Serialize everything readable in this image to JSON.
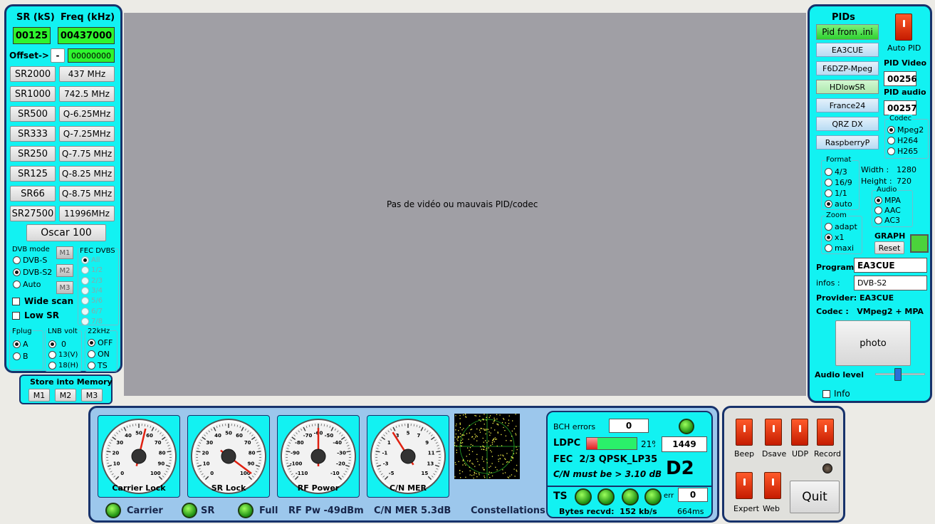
{
  "left": {
    "sr_header": "SR (kS)",
    "freq_header": "Freq (kHz)",
    "sr_value": "00125",
    "freq_value": "00437000",
    "offset_label": "Offset->",
    "offset_sign": "-",
    "offset_value": "00000000",
    "sr_buttons": [
      "SR2000",
      "SR1000",
      "SR500",
      "SR333",
      "SR250",
      "SR125",
      "SR66",
      "SR27500"
    ],
    "freq_buttons": [
      "437 MHz",
      "742.5 MHz",
      "Q-6.25MHz",
      "Q-7.25MHz",
      "Q-7.75 MHz",
      "Q-8.25 MHz",
      "Q-8.75 MHz",
      "11996MHz"
    ],
    "oscar_button": "Oscar 100",
    "dvb_mode_title": "DVB mode",
    "dvb_modes": [
      "DVB-S",
      "DVB-S2",
      "Auto"
    ],
    "m_buttons": [
      "M1",
      "M2",
      "M3"
    ],
    "fec_title": "FEC DVBS",
    "fec_options": [
      "All",
      "1/2",
      "2/3",
      "3/4",
      "5/6",
      "6/7",
      "7/8"
    ],
    "wide_scan": "Wide scan",
    "low_sr": "Low SR",
    "fplug_title": "Fplug",
    "fplug_options": [
      "A",
      "B"
    ],
    "lnb_title": "LNB volt",
    "lnb_options": [
      "0",
      "13(V)",
      "18(H)"
    ],
    "khz_title": "22kHz",
    "khz_options": [
      "OFF",
      "ON",
      "TS"
    ],
    "store_title": "Store into Memory",
    "store_buttons": [
      "M1",
      "M2",
      "M3"
    ]
  },
  "video": {
    "message": "Pas de vidéo ou mauvais PID/codec"
  },
  "right": {
    "pids_title": "PIDs",
    "pid_buttons": [
      "Pid from .ini",
      "EA3CUE",
      "F6DZP-Mpeg",
      "HDlowSR",
      "France24",
      "QRZ DX",
      "RaspberryP"
    ],
    "auto_pid": "Auto PID",
    "pid_video_label": "PID Video",
    "pid_video_value": "00256",
    "pid_audio_label": "PID audio",
    "pid_audio_value": "00257",
    "codec_title": "Codec",
    "codec_options": [
      "Mpeg2",
      "H264",
      "H265"
    ],
    "format_title": "Format",
    "format_options": [
      "4/3",
      "16/9",
      "1/1",
      "auto"
    ],
    "width_label": "Width :",
    "width_value": "1280",
    "height_label": "Height :",
    "height_value": "720",
    "audio_title": "Audio",
    "audio_options": [
      "MPA",
      "AAC",
      "AC3"
    ],
    "zoom_title": "Zoom",
    "zoom_options": [
      "adapt",
      "x1",
      "maxi"
    ],
    "graph_label": "GRAPH",
    "reset_button": "Reset",
    "program_label": "Program",
    "program_value": "EA3CUE",
    "infos_label": "infos :",
    "infos_value": "DVB-S2",
    "provider_line": "Provider: EA3CUE",
    "codec_line": "Codec :   VMpeg2 + MPA",
    "photo_button": "photo",
    "audio_level_label": "Audio level",
    "audio_level": 0.45,
    "info_label": "Info"
  },
  "gauges": [
    {
      "label": "Carrier Lock",
      "ticks": [
        "0",
        "10",
        "20",
        "30",
        "40",
        "50",
        "60",
        "70",
        "80",
        "90",
        "100"
      ],
      "value_fraction": 0.55
    },
    {
      "label": "SR Lock",
      "ticks": [
        "0",
        "10",
        "20",
        "30",
        "40",
        "50",
        "60",
        "70",
        "80",
        "90",
        "100"
      ],
      "value_fraction": 0.97
    },
    {
      "label": "RF Power",
      "ticks": [
        "-110",
        "-100",
        "-90",
        "-80",
        "-70",
        "-60",
        "-50",
        "-40",
        "-30",
        "-20",
        "-10"
      ],
      "value_fraction": 0.5
    },
    {
      "label": "C/N MER",
      "ticks": [
        "-5",
        "-3",
        "-1",
        "1",
        "3",
        "5",
        "7",
        "9",
        "11",
        "13",
        "15"
      ],
      "value_fraction": 0.38
    }
  ],
  "status": {
    "carrier": "Carrier",
    "sr": "SR",
    "full": "Full",
    "rf_pw": "RF Pw -49dBm",
    "cn_mer": "C/N MER 5.3dB",
    "constellations": "Constellations"
  },
  "decoder": {
    "bch_label": "BCH errors",
    "bch_value": "0",
    "ldpc_label": "LDPC",
    "ldpc_percent_text": "21%",
    "ldpc_fraction": 0.21,
    "ldpc_value": "1449",
    "fec_line": "FEC  2/3 QPSK_LP35",
    "cn_line": "C/N must be > 3.10 dB",
    "d2": "D2",
    "ts_label": "TS",
    "err_label": "err",
    "err_value": "0",
    "bytes_line": "Bytes recvd:  152 kb/s",
    "ms_value": "664ms"
  },
  "controls": {
    "switches": [
      "Beep",
      "Dsave",
      "UDP",
      "Record"
    ],
    "switches2": [
      "Expert",
      "Web"
    ],
    "quit_button": "Quit"
  },
  "colors": {
    "panel": "#12f2f2",
    "border": "#17326b",
    "led_green": "#2fd12f",
    "switch_red": "#e83a10"
  }
}
